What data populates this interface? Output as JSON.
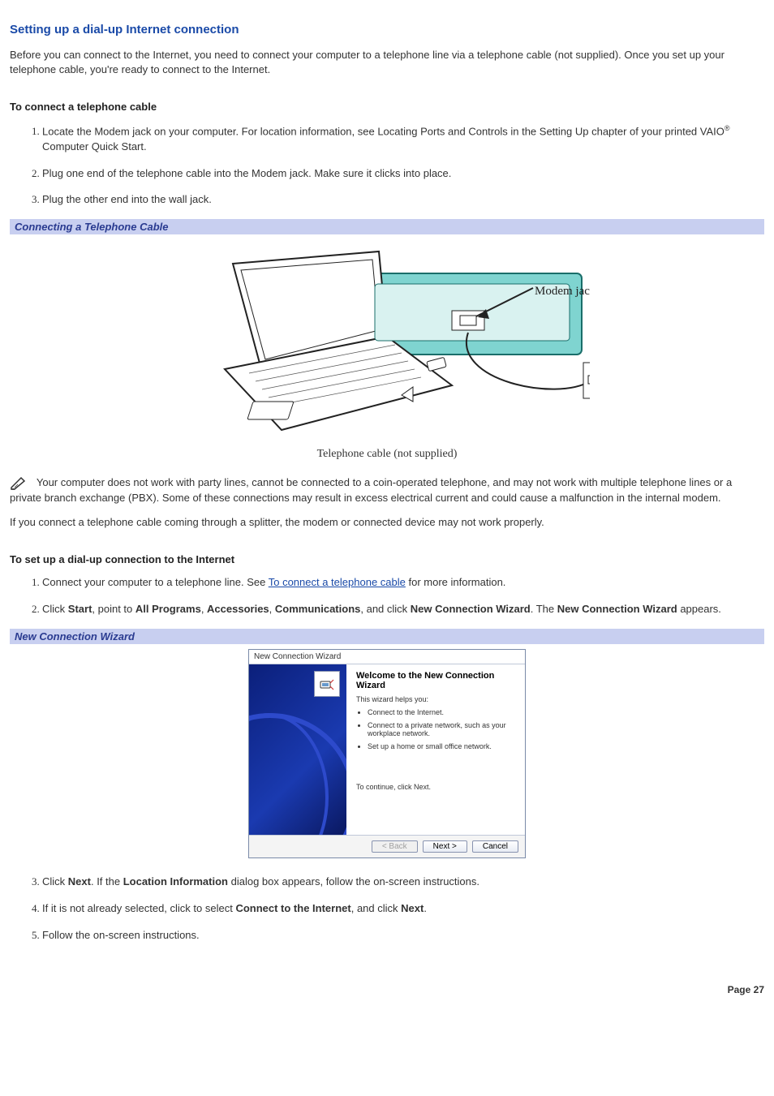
{
  "title": "Setting up a dial-up Internet connection",
  "intro": "Before you can connect to the Internet, you need to connect your computer to a telephone line via a telephone cable (not supplied). Once you set up your telephone cable, you're ready to connect to the Internet.",
  "section1": {
    "heading": "To connect a telephone cable",
    "steps": {
      "s1_pre": "Locate the Modem jack on your computer. For location information, see Locating Ports and Controls in the Setting Up chapter of your printed VAIO",
      "s1_post": " Computer Quick Start.",
      "s2": "Plug one end of the telephone cable into the Modem jack. Make sure it clicks into place.",
      "s3": "Plug the other end into the wall jack."
    }
  },
  "figure1": {
    "caption": "Connecting a Telephone Cable",
    "label_modem": "Modem jack",
    "label_cable": "Telephone cable (not supplied)"
  },
  "note": {
    "pre": "Your computer does not work with party lines, cannot be connected to a coin-operated telephone, and may not work with multiple telephone lines or a private branch exchange (PBX). Some of these connections may result in excess electrical current and could cause a malfunction in the internal modem."
  },
  "splitter_para": "If you connect a telephone cable coming through a splitter, the modem or connected device may not work properly.",
  "section2": {
    "heading": "To set up a dial-up connection to the Internet",
    "s1_pre": "Connect your computer to a telephone line. See ",
    "s1_link": "To connect a telephone cable",
    "s1_post": " for more information.",
    "s2": {
      "t1": "Click ",
      "b1": "Start",
      "t2": ", point to ",
      "b2": "All Programs",
      "t3": ", ",
      "b3": "Accessories",
      "t4": ", ",
      "b4": "Communications",
      "t5": ", and click ",
      "b5": "New Connection Wizard",
      "t6": ". The ",
      "b6": "New Connection Wizard",
      "t7": " appears."
    },
    "s3": {
      "t1": "Click ",
      "b1": "Next",
      "t2": ". If the ",
      "b2": "Location Information",
      "t3": " dialog box appears, follow the on-screen instructions."
    },
    "s4": {
      "t1": "If it is not already selected, click to select ",
      "b1": "Connect to the Internet",
      "t2": ", and click ",
      "b2": "Next",
      "t3": "."
    },
    "s5": "Follow the on-screen instructions."
  },
  "figure2": {
    "caption": "New Connection Wizard",
    "window_title": "New Connection Wizard",
    "heading": "Welcome to the New Connection Wizard",
    "helps": "This wizard helps you:",
    "bullets": [
      "Connect to the Internet.",
      "Connect to a private network, such as your workplace network.",
      "Set up a home or small office network."
    ],
    "continue": "To continue, click Next.",
    "btn_back": "< Back",
    "btn_next": "Next >",
    "btn_cancel": "Cancel"
  },
  "page_label": "Page 27",
  "reg_mark": "®"
}
